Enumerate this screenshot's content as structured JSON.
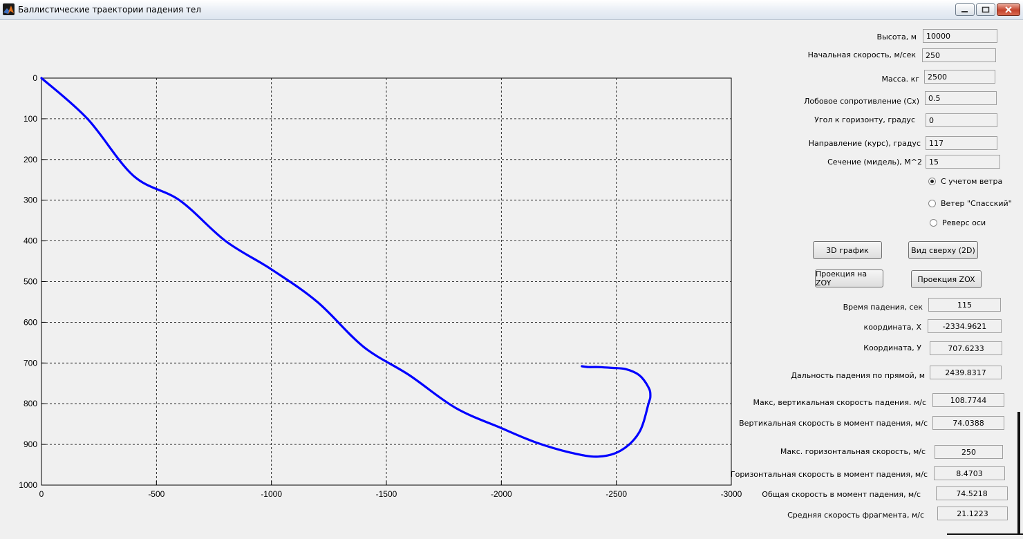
{
  "window": {
    "title": "Баллистические траектории падения тел"
  },
  "inputs": [
    {
      "id": "height",
      "label": "Высота, м",
      "value": "10000"
    },
    {
      "id": "velocity",
      "label": "Начальная скорость, м/сек",
      "value": "250"
    },
    {
      "id": "mass",
      "label": "Масса. кг",
      "value": "2500"
    },
    {
      "id": "drag",
      "label": "Лобовое сопротивление (Cx)",
      "value": "0.5"
    },
    {
      "id": "angle",
      "label": "Угол к горизонту, градус",
      "value": "0"
    },
    {
      "id": "heading",
      "label": "Направление  (курс), градус",
      "value": "117"
    },
    {
      "id": "section",
      "label": "Сечение (мидель), М^2",
      "value": "15"
    }
  ],
  "options": [
    {
      "id": "wind",
      "label": "С учетом ветра",
      "selected": true
    },
    {
      "id": "spassky",
      "label": "Ветер \"Спасский\"",
      "selected": false
    },
    {
      "id": "reverse",
      "label": "Реверс оси",
      "selected": false
    }
  ],
  "buttons": {
    "graph3d": "3D график",
    "topview": "Вид сверху (2D)",
    "proj_zoy": "Проекция на ZOY",
    "proj_zox": "Проекция ZOX"
  },
  "results": [
    {
      "id": "fall_time",
      "label": "Время падения, сек",
      "value": "115"
    },
    {
      "id": "coord_x",
      "label": "координата, X",
      "value": "-2334.9621"
    },
    {
      "id": "coord_y",
      "label": "Координата, У",
      "value": "707.6233"
    },
    {
      "id": "range",
      "label": "Дальность падения по прямой, м",
      "value": "2439.8317"
    },
    {
      "id": "max_vv",
      "label": "Макс,  вертикальная скорость падения. м/с",
      "value": "108.7744"
    },
    {
      "id": "vv_impact",
      "label": "Вертикальная  скорость в момент падения, м/с",
      "value": "74.0388"
    },
    {
      "id": "max_vh",
      "label": "Макс. горизонтальная скорость, м/с",
      "value": "250"
    },
    {
      "id": "vh_impact",
      "label": "Горизонтальная скорость в момент падения, м/с",
      "value": "8.4703"
    },
    {
      "id": "v_impact",
      "label": "Общая скорость в момент падения, м/с",
      "value": "74.5218"
    },
    {
      "id": "v_avg",
      "label": "Средняя скорость фрагмента, м/с",
      "value": "21.1223"
    }
  ],
  "chart_data": {
    "type": "line",
    "title": "",
    "xlabel": "",
    "ylabel": "",
    "xlim": [
      0,
      -3000
    ],
    "ylim": [
      0,
      1000
    ],
    "y_reversed": true,
    "x_ticks": [
      "0",
      "-500",
      "-1000",
      "-1500",
      "-2000",
      "-2500",
      "-3000"
    ],
    "y_ticks": [
      "0",
      "100",
      "200",
      "300",
      "400",
      "500",
      "600",
      "700",
      "800",
      "900",
      "1000"
    ],
    "grid": true,
    "line_color": "#0000ff",
    "series": [
      {
        "x": [
          0,
          -200,
          -400,
          -600,
          -800,
          -1000,
          -1200,
          -1400,
          -1600,
          -1800,
          -2000,
          -2150,
          -2300,
          -2420,
          -2520,
          -2600,
          -2640,
          -2648,
          -2640,
          -2600,
          -2540,
          -2480,
          -2420,
          -2380,
          -2350
        ],
        "y": [
          0,
          100,
          240,
          300,
          400,
          470,
          550,
          660,
          730,
          810,
          860,
          895,
          920,
          930,
          915,
          870,
          800,
          780,
          760,
          730,
          715,
          712,
          710,
          710,
          708
        ]
      }
    ]
  }
}
